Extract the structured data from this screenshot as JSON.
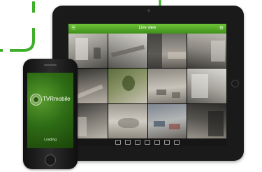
{
  "accent_color": "#5bb52f",
  "tablet": {
    "title_bar": {
      "title": "Live view",
      "left_icon": "menu-icon",
      "right_icon": "settings-icon"
    },
    "cameras": [
      "camera-1",
      "camera-2",
      "camera-3",
      "camera-4",
      "camera-5",
      "camera-6",
      "camera-7",
      "camera-8",
      "camera-9",
      "camera-10",
      "camera-11",
      "camera-12"
    ],
    "toolbar_icons": [
      "layout-icon",
      "playback-icon",
      "record-icon",
      "snapshot-icon",
      "ptz-icon",
      "audio-icon",
      "fullscreen-icon"
    ]
  },
  "phone": {
    "app_name": "TVRmobile",
    "status": "Loading"
  }
}
